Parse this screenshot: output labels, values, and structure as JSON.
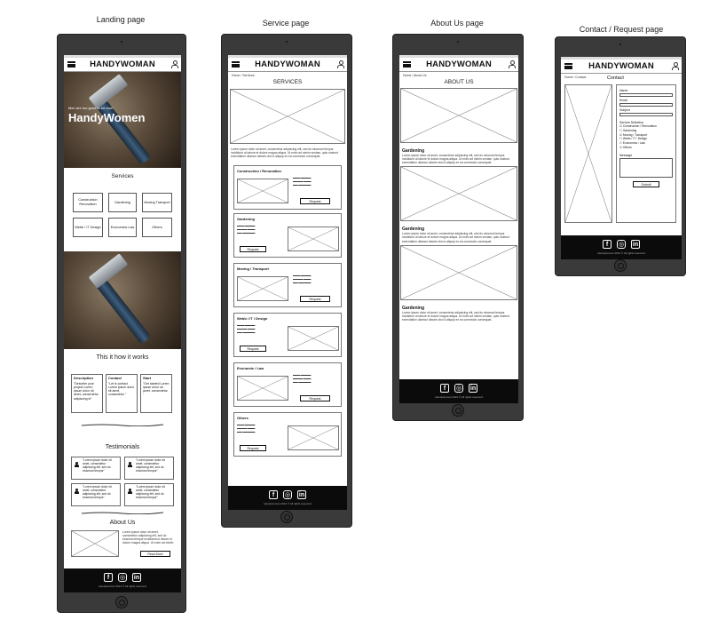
{
  "labels": {
    "landing": "Landing page",
    "service": "Service page",
    "about": "About Us page",
    "contact": "Contact / Request page"
  },
  "brand": "HANDYWOMAN",
  "landing": {
    "hero_sub": "Men are too good to be true!",
    "hero_title": "HandyWomen",
    "services_title": "Services",
    "services": [
      "Construction Renovation",
      "Gardening",
      "Moving Transport",
      "Webb / IT Design",
      "Economics Law",
      "Others"
    ],
    "how_title": "This it how it works",
    "steps": [
      {
        "title": "Description",
        "text": "\"Describe your project Lorem ipsum dolor sit amet, consectetur adipiscing el\""
      },
      {
        "title": "Contact",
        "text": "\"Let is contact Lorem ipsum dolor sit amet, consectetur \""
      },
      {
        "title": "Start",
        "text": "\"Get started Lorem ipsum dolor sit amet, consectetur \""
      }
    ],
    "testimonials_title": "Testimonials",
    "testimonial_text": "\"Lorem ipsum dolor sit amet, consectetur adipiscing elit, sed do eiusmod tempor\"",
    "about_title": "About Us",
    "about_text": "Lorem ipsum dolor sit amet, consectetur adipiscing elit, sed do eiusmod tempor incididunt ut labore et dolore magna aliqua. Ut enim ad minim",
    "read_more": "Read More"
  },
  "service": {
    "crumb": "Home / Services",
    "title": "SERVICES",
    "intro": "Lorem ipsum dolor sit amet, consectetur adipiscing elit, sed do eiusmod tempor incididunt ut labore et dolore magna aliqua. Ut enim ad minim veniam, quis nostrud exercitation ullamco laboris nisi ut aliquip ex ea commodo consequat.",
    "items": [
      "Construction / Renovation",
      "Gardening",
      "Moving / Transport",
      "Webb / IT / Design",
      "Economic / Law",
      "Others"
    ],
    "request": "Request"
  },
  "about": {
    "crumb": "Home / About Us",
    "title": "ABOUT US",
    "heading": "Gardening",
    "text": "Lorem ipsum dolor sit amet, consectetur adipiscing elit, sed do eiusmod tempor incididunt ut labore et dolore magna aliqua. Ut enim ad minim veniam, quis nostrud exercitation ullamco laboris nisi ut aliquip ex ea commodo consequat."
  },
  "contact": {
    "crumb": "Home / Contact",
    "title": "Contact",
    "name": "Name",
    "email": "Email",
    "subject": "Subject",
    "selection": "Service Selection",
    "options": [
      "☑ Construction / Renovation",
      "☐ Gardening",
      "☑ Moving / Transport",
      "☐ Webb / IT / Design",
      "☐ Economics / Law",
      "☑ Others"
    ],
    "message": "Message",
    "submit": "Submit"
  },
  "footer": {
    "copy": "Handywoman 2021 © All rights reserved",
    "icons": [
      "facebook-icon",
      "instagram-icon",
      "linkedin-icon"
    ]
  }
}
